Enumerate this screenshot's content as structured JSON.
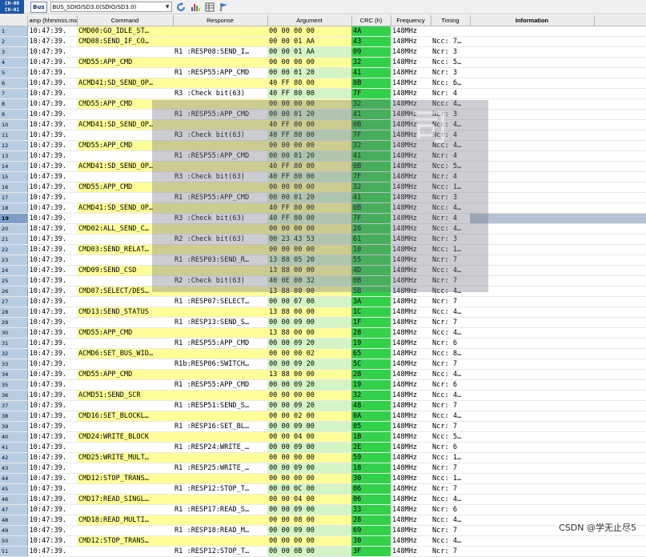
{
  "toolbar": {
    "channel_top": "CH-00",
    "channel_bottom": "CH-01",
    "bus_label": "Bus",
    "path_value": "BUS_SDIO/SD3.0(SDIO/SD3.0)",
    "icons": [
      "refresh-icon",
      "bar-chart-icon",
      "grid-icon",
      "flag-icon"
    ]
  },
  "columns": {
    "timestamp": "amp (hhmmss.ms",
    "command": "Command",
    "response": "Response",
    "argument": "Argument",
    "crc": "CRC (h)",
    "frequency": "Frequency",
    "timing": "Timing",
    "information": "Information"
  },
  "colors": {
    "cmd_yellow": "#ffff99",
    "arg_green": "#d3f5c6",
    "crc_green": "#33d14a",
    "row_index": "#b9cde2",
    "selected_info": "#b3c3d3"
  },
  "watermark_text": "司",
  "footer": "CSDN @学无止尽5",
  "selected_row": 19,
  "rows": [
    {
      "n": "1",
      "ts": "10:47:39.",
      "cmd": "CMD00:GO_IDLE_ST…",
      "rsp": "",
      "arg": "00 00 00 00",
      "crc": "4A",
      "fq": "148MHz",
      "tm": ""
    },
    {
      "n": "2",
      "ts": "10:47:39.",
      "cmd": "CMD08:SEND_IF_CO…",
      "rsp": "",
      "arg": "00 00 01 AA",
      "crc": "43",
      "fq": "148MHz",
      "tm": "Ncc: 7…"
    },
    {
      "n": "3",
      "ts": "10:47:39.",
      "cmd": "",
      "rsp": "R1 :RESP08:SEND_I…",
      "arg": "00 00 01 AA",
      "crc": "09",
      "fq": "148MHz",
      "tm": "Ncr: 3"
    },
    {
      "n": "4",
      "ts": "10:47:39.",
      "cmd": "CMD55:APP_CMD",
      "rsp": "",
      "arg": "00 00 00 00",
      "crc": "32",
      "fq": "148MHz",
      "tm": "Ncc: 5…"
    },
    {
      "n": "5",
      "ts": "10:47:39.",
      "cmd": "",
      "rsp": "R1 :RESP55:APP_CMD",
      "arg": "00 00 01 20",
      "crc": "41",
      "fq": "148MHz",
      "tm": "Ncr: 3"
    },
    {
      "n": "6",
      "ts": "10:47:39.",
      "cmd": "ACMD41:SD_SEND_OP…",
      "rsp": "",
      "arg": "40 FF 80 00",
      "crc": "0B",
      "fq": "148MHz",
      "tm": "Ncc: 6…"
    },
    {
      "n": "7",
      "ts": "10:47:39.",
      "cmd": "",
      "rsp": "R3 :Check bit(63)",
      "arg": "40 FF 80 00",
      "crc": "7F",
      "fq": "148MHz",
      "tm": "Ncr: 4"
    },
    {
      "n": "8",
      "ts": "10:47:39.",
      "cmd": "CMD55:APP_CMD",
      "rsp": "",
      "arg": "00 00 00 00",
      "crc": "32",
      "fq": "148MHz",
      "tm": "Ncc: 4…"
    },
    {
      "n": "9",
      "ts": "10:47:39.",
      "cmd": "",
      "rsp": "R1 :RESP55:APP_CMD",
      "arg": "00 00 01 20",
      "crc": "41",
      "fq": "148MHz",
      "tm": "Ncr: 3"
    },
    {
      "n": "10",
      "ts": "10:47:39.",
      "cmd": "ACMD41:SD_SEND_OP…",
      "rsp": "",
      "arg": "40 FF 80 00",
      "crc": "0B",
      "fq": "148MHz",
      "tm": "Ncc: 4…"
    },
    {
      "n": "11",
      "ts": "10:47:39.",
      "cmd": "",
      "rsp": "R3 :Check bit(63)",
      "arg": "40 FF 80 00",
      "crc": "7F",
      "fq": "148MHz",
      "tm": "Ncr: 4"
    },
    {
      "n": "12",
      "ts": "10:47:39.",
      "cmd": "CMD55:APP_CMD",
      "rsp": "",
      "arg": "00 00 00 00",
      "crc": "32",
      "fq": "148MHz",
      "tm": "Ncc: 4…"
    },
    {
      "n": "13",
      "ts": "10:47:39.",
      "cmd": "",
      "rsp": "R1 :RESP55:APP_CMD",
      "arg": "00 00 01 20",
      "crc": "41",
      "fq": "148MHz",
      "tm": "Ncr: 4"
    },
    {
      "n": "14",
      "ts": "10:47:39.",
      "cmd": "ACMD41:SD_SEND_OP…",
      "rsp": "",
      "arg": "40 FF 80 00",
      "crc": "0B",
      "fq": "148MHz",
      "tm": "Ncc: 5…"
    },
    {
      "n": "15",
      "ts": "10:47:39.",
      "cmd": "",
      "rsp": "R3 :Check bit(63)",
      "arg": "40 FF 80 00",
      "crc": "7F",
      "fq": "148MHz",
      "tm": "Ncr: 4"
    },
    {
      "n": "16",
      "ts": "10:47:39.",
      "cmd": "CMD55:APP_CMD",
      "rsp": "",
      "arg": "00 00 00 00",
      "crc": "32",
      "fq": "148MHz",
      "tm": "Ncc: 1…"
    },
    {
      "n": "17",
      "ts": "10:47:39.",
      "cmd": "",
      "rsp": "R1 :RESP55:APP_CMD",
      "arg": "00 00 01 20",
      "crc": "41",
      "fq": "148MHz",
      "tm": "Ncr: 3"
    },
    {
      "n": "18",
      "ts": "10:47:39.",
      "cmd": "ACMD41:SD_SEND_OP…",
      "rsp": "",
      "arg": "40 FF 80 00",
      "crc": "0B",
      "fq": "148MHz",
      "tm": "Ncc: 4…"
    },
    {
      "n": "19",
      "ts": "10:47:39.",
      "cmd": "",
      "rsp": "R3 :Check bit(63)",
      "arg": "40 FF 80 00",
      "crc": "7F",
      "fq": "148MHz",
      "tm": "Ncr: 4"
    },
    {
      "n": "20",
      "ts": "10:47:39.",
      "cmd": "CMD02:ALL_SEND_C…",
      "rsp": "",
      "arg": "00 00 00 00",
      "crc": "26",
      "fq": "148MHz",
      "tm": "Ncc: 4…"
    },
    {
      "n": "21",
      "ts": "10:47:39.",
      "cmd": "",
      "rsp": "R2 :Check bit(63)",
      "arg": "00 23 43 53",
      "crc": "61",
      "fq": "148MHz",
      "tm": "Ncr: 3"
    },
    {
      "n": "22",
      "ts": "10:47:39.",
      "cmd": "CMD03:SEND_RELAT…",
      "rsp": "",
      "arg": "00 00 00 00",
      "crc": "10",
      "fq": "148MHz",
      "tm": "Ncc: 1…"
    },
    {
      "n": "23",
      "ts": "10:47:39.",
      "cmd": "",
      "rsp": "R1 :RESP03:SEND_R…",
      "arg": "13 88 05 20",
      "crc": "55",
      "fq": "148MHz",
      "tm": "Ncr: 7"
    },
    {
      "n": "24",
      "ts": "10:47:39.",
      "cmd": "CMD09:SEND_CSD",
      "rsp": "",
      "arg": "13 88 00 00",
      "crc": "4D",
      "fq": "148MHz",
      "tm": "Ncc: 4…"
    },
    {
      "n": "25",
      "ts": "10:47:39.",
      "cmd": "",
      "rsp": "R2 :Check bit(63)",
      "arg": "40 0E 00 32",
      "crc": "0B",
      "fq": "148MHz",
      "tm": "Ncr: 7"
    },
    {
      "n": "26",
      "ts": "10:47:39.",
      "cmd": "CMD07:SELECT/DES…",
      "rsp": "",
      "arg": "13 88 00 00",
      "crc": "5B",
      "fq": "148MHz",
      "tm": "Ncc: 4…"
    },
    {
      "n": "27",
      "ts": "10:47:39.",
      "cmd": "",
      "rsp": "R1 :RESP07:SELECT…",
      "arg": "00 00 07 00",
      "crc": "3A",
      "fq": "148MHz",
      "tm": "Ncr: 7"
    },
    {
      "n": "28",
      "ts": "10:47:39.",
      "cmd": "CMD13:SEND_STATUS",
      "rsp": "",
      "arg": "13 88 00 00",
      "crc": "1C",
      "fq": "148MHz",
      "tm": "Ncc: 4…"
    },
    {
      "n": "29",
      "ts": "10:47:39.",
      "cmd": "",
      "rsp": "R1 :RESP13:SEND_S…",
      "arg": "00 00 09 00",
      "crc": "1F",
      "fq": "148MHz",
      "tm": "Ncr: 7"
    },
    {
      "n": "30",
      "ts": "10:47:39.",
      "cmd": "CMD55:APP_CMD",
      "rsp": "",
      "arg": "13 88 00 00",
      "crc": "28",
      "fq": "148MHz",
      "tm": "Ncc: 4…"
    },
    {
      "n": "31",
      "ts": "10:47:39.",
      "cmd": "",
      "rsp": "R1 :RESP55:APP_CMD",
      "arg": "00 00 09 20",
      "crc": "19",
      "fq": "148MHz",
      "tm": "Ncr: 6"
    },
    {
      "n": "32",
      "ts": "10:47:39.",
      "cmd": "ACMD6:SET_BUS_WID…",
      "rsp": "",
      "arg": "00 00 00 02",
      "crc": "65",
      "fq": "148MHz",
      "tm": "Ncc: 8…"
    },
    {
      "n": "33",
      "ts": "10:47:39.",
      "cmd": "",
      "rsp": "R1b:RESP06:SWITCH…",
      "arg": "00 00 09 20",
      "crc": "5C",
      "fq": "148MHz",
      "tm": "Ncr: 7"
    },
    {
      "n": "34",
      "ts": "10:47:39.",
      "cmd": "CMD55:APP_CMD",
      "rsp": "",
      "arg": "13 88 00 00",
      "crc": "28",
      "fq": "148MHz",
      "tm": "Ncc: 4…"
    },
    {
      "n": "35",
      "ts": "10:47:39.",
      "cmd": "",
      "rsp": "R1 :RESP55:APP_CMD",
      "arg": "00 00 09 20",
      "crc": "19",
      "fq": "148MHz",
      "tm": "Ncr: 6"
    },
    {
      "n": "36",
      "ts": "10:47:39.",
      "cmd": "ACMD51:SEND_SCR",
      "rsp": "",
      "arg": "00 00 00 00",
      "crc": "32",
      "fq": "148MHz",
      "tm": "Ncc: 4…"
    },
    {
      "n": "37",
      "ts": "10:47:39.",
      "cmd": "",
      "rsp": "R1 :RESP51:SEND_S…",
      "arg": "00 00 09 20",
      "crc": "48",
      "fq": "148MHz",
      "tm": "Ncr: 7"
    },
    {
      "n": "38",
      "ts": "10:47:39.",
      "cmd": "CMD16:SET_BLOCKL…",
      "rsp": "",
      "arg": "00 00 02 00",
      "crc": "0A",
      "fq": "148MHz",
      "tm": "Ncc: 4…"
    },
    {
      "n": "39",
      "ts": "10:47:39.",
      "cmd": "",
      "rsp": "R1 :RESP16:SET_BL…",
      "arg": "00 00 09 00",
      "crc": "05",
      "fq": "148MHz",
      "tm": "Ncr: 7"
    },
    {
      "n": "40",
      "ts": "10:47:39.",
      "cmd": "CMD24:WRITE_BLOCK",
      "rsp": "",
      "arg": "00 00 04 00",
      "crc": "1B",
      "fq": "148MHz",
      "tm": "Ncc: 5…"
    },
    {
      "n": "41",
      "ts": "10:47:39.",
      "cmd": "",
      "rsp": "R1 :RESP24:WRITE_…",
      "arg": "00 00 09 00",
      "crc": "2E",
      "fq": "148MHz",
      "tm": "Ncr: 6"
    },
    {
      "n": "42",
      "ts": "10:47:39.",
      "cmd": "CMD25:WRITE_MULT…",
      "rsp": "",
      "arg": "00 00 00 00",
      "crc": "59",
      "fq": "148MHz",
      "tm": "Ncc: 1…"
    },
    {
      "n": "43",
      "ts": "10:47:39.",
      "cmd": "",
      "rsp": "R1 :RESP25:WRITE_…",
      "arg": "00 00 09 00",
      "crc": "18",
      "fq": "148MHz",
      "tm": "Ncr: 7"
    },
    {
      "n": "44",
      "ts": "10:47:39.",
      "cmd": "CMD12:STOP_TRANS…",
      "rsp": "",
      "arg": "00 00 00 00",
      "crc": "30",
      "fq": "148MHz",
      "tm": "Ncc: 1…"
    },
    {
      "n": "45",
      "ts": "10:47:39.",
      "cmd": "",
      "rsp": "R1 :RESP12:STOP_T…",
      "arg": "00 00 0C 00",
      "crc": "06",
      "fq": "148MHz",
      "tm": "Ncr: 7"
    },
    {
      "n": "46",
      "ts": "10:47:39.",
      "cmd": "CMD17:READ_SINGL…",
      "rsp": "",
      "arg": "00 00 04 00",
      "crc": "06",
      "fq": "148MHz",
      "tm": "Ncc: 4…"
    },
    {
      "n": "47",
      "ts": "10:47:39.",
      "cmd": "",
      "rsp": "R1 :RESP17:READ_S…",
      "arg": "00 00 09 00",
      "crc": "33",
      "fq": "148MHz",
      "tm": "Ncr: 6"
    },
    {
      "n": "48",
      "ts": "10:47:39.",
      "cmd": "CMD18:READ_MULTI…",
      "rsp": "",
      "arg": "00 00 08 00",
      "crc": "28",
      "fq": "148MHz",
      "tm": "Ncc: 4…"
    },
    {
      "n": "49",
      "ts": "10:47:39.",
      "cmd": "",
      "rsp": "R1 :RESP18:READ_M…",
      "arg": "00 00 09 00",
      "crc": "69",
      "fq": "148MHz",
      "tm": "Ncr: 7"
    },
    {
      "n": "50",
      "ts": "10:47:39.",
      "cmd": "CMD12:STOP_TRANS…",
      "rsp": "",
      "arg": "00 00 00 00",
      "crc": "30",
      "fq": "148MHz",
      "tm": "Ncc: 4…"
    },
    {
      "n": "51",
      "ts": "10:47:39.",
      "cmd": "",
      "rsp": "R1 :RESP12:STOP_T…",
      "arg": "00 00 0B 00",
      "crc": "3F",
      "fq": "148MHz",
      "tm": "Ncr: 7"
    }
  ]
}
